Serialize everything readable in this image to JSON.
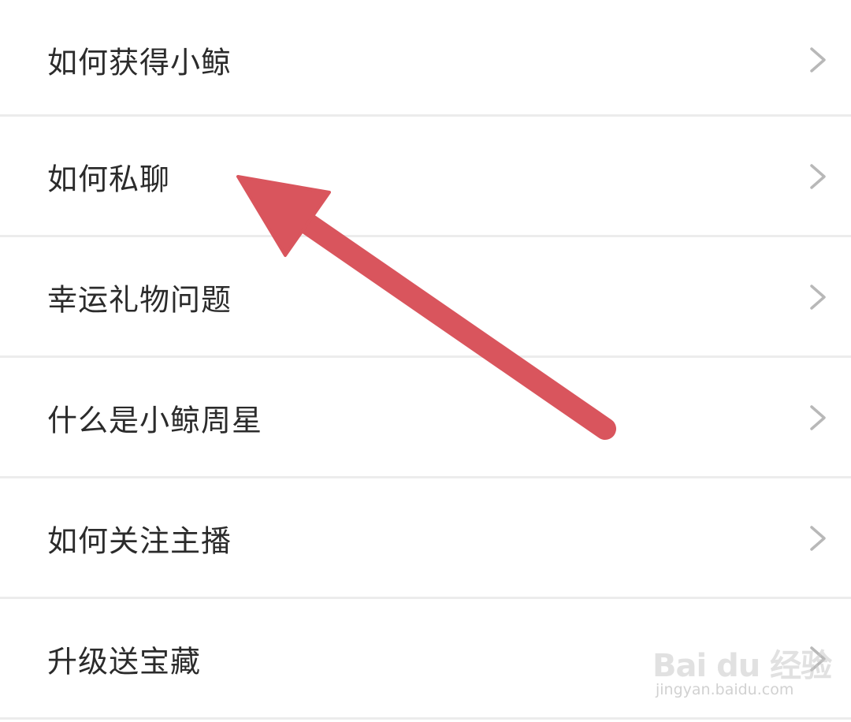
{
  "menu": {
    "items": [
      {
        "label": "如何获得小鲸"
      },
      {
        "label": "如何私聊"
      },
      {
        "label": "幸运礼物问题"
      },
      {
        "label": "什么是小鲸周星"
      },
      {
        "label": "如何关注主播"
      },
      {
        "label": "升级送宝藏"
      }
    ]
  },
  "annotation": {
    "arrow_color": "#d9555d"
  },
  "watermark": {
    "brand": "Bai du 经验",
    "url": "jingyan.baidu.com"
  },
  "colors": {
    "background": "#ffffff",
    "divider": "#ececec",
    "text": "#2b2b2b",
    "chevron": "#b8b8b8"
  }
}
